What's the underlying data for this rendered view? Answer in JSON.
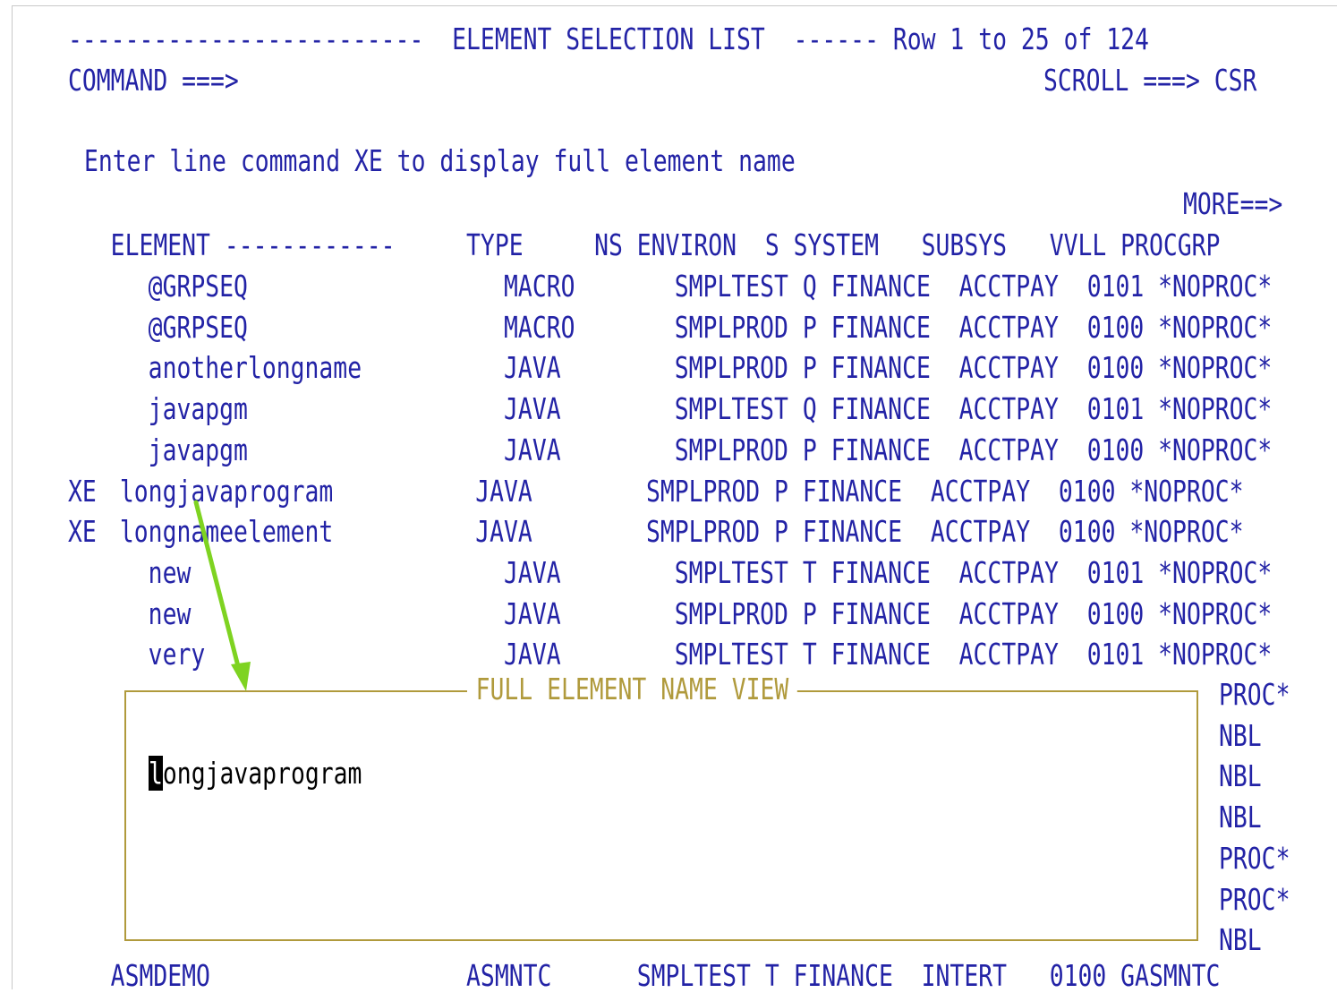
{
  "header": {
    "title_line": "-------------------------  ELEMENT SELECTION LIST  ------ Row 1 to 25 of 124",
    "command_label": "COMMAND ===>",
    "command_value": "",
    "scroll_label": "SCROLL ===> CSR"
  },
  "instruction": "Enter line command XE to display full element name",
  "more_indicator": "MORE==>",
  "columns_header": "   ELEMENT ------------     TYPE     NS ENVIRON  S SYSTEM   SUBSYS   VVLL PROCGRP",
  "rows": [
    {
      "cmd": "  ",
      "text": "   @GRPSEQ                  MACRO       SMPLTEST Q FINANCE  ACCTPAY  0101 *NOPROC*"
    },
    {
      "cmd": "  ",
      "text": "   @GRPSEQ                  MACRO       SMPLPROD P FINANCE  ACCTPAY  0100 *NOPROC*"
    },
    {
      "cmd": "  ",
      "text": "   anotherlongname          JAVA        SMPLPROD P FINANCE  ACCTPAY  0100 *NOPROC*"
    },
    {
      "cmd": "  ",
      "text": "   javapgm                  JAVA        SMPLTEST Q FINANCE  ACCTPAY  0101 *NOPROC*"
    },
    {
      "cmd": "  ",
      "text": "   javapgm                  JAVA        SMPLPROD P FINANCE  ACCTPAY  0100 *NOPROC*"
    },
    {
      "cmd": "XE",
      "text": " longjavaprogram          JAVA        SMPLPROD P FINANCE  ACCTPAY  0100 *NOPROC*"
    },
    {
      "cmd": "XE",
      "text": " longnameelement          JAVA        SMPLPROD P FINANCE  ACCTPAY  0100 *NOPROC*"
    },
    {
      "cmd": "  ",
      "text": "   new                      JAVA        SMPLTEST T FINANCE  ACCTPAY  0101 *NOPROC*"
    },
    {
      "cmd": "  ",
      "text": "   new                      JAVA        SMPLPROD P FINANCE  ACCTPAY  0100 *NOPROC*"
    },
    {
      "cmd": "  ",
      "text": "   very                     JAVA        SMPLTEST T FINANCE  ACCTPAY  0101 *NOPROC*"
    }
  ],
  "popup": {
    "title": "FULL ELEMENT NAME VIEW",
    "value_first_char": "l",
    "value_rest": "ongjavaprogram"
  },
  "hidden_row_tails": [
    "PROC*",
    "NBL",
    "NBL",
    "NBL",
    "PROC*",
    "PROC*",
    "NBL"
  ],
  "last_row": "   ASMDEMO                  ASMNTC      SMPLTEST T FINANCE  INTERT   0100 GASMNTC",
  "colors": {
    "text": "#2323a6",
    "popup_border": "#b09a3c",
    "arrow": "#7ed321"
  }
}
